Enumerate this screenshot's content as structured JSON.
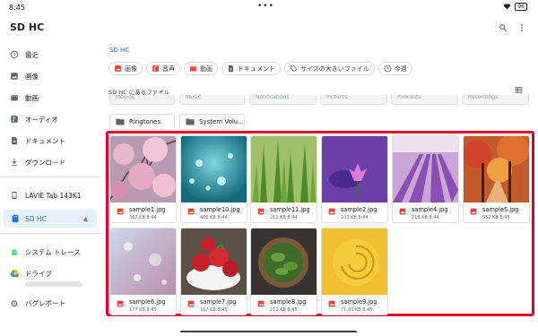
{
  "status_bar": {
    "time": "8:45",
    "dots": "•••",
    "battery": "96"
  },
  "app_bar": {
    "title": "SD HC",
    "search_icon": "search-icon",
    "more_icon": "more-vert-icon"
  },
  "sidebar": {
    "items": [
      {
        "label": "最近",
        "icon": "clock-icon"
      },
      {
        "label": "画像",
        "icon": "image-icon"
      },
      {
        "label": "動画",
        "icon": "movie-icon"
      },
      {
        "label": "オーディオ",
        "icon": "audio-icon"
      },
      {
        "label": "ドキュメント",
        "icon": "document-icon"
      },
      {
        "label": "ダウンロード",
        "icon": "download-icon"
      }
    ],
    "devices": [
      {
        "label": "LAVIE Tab 143K1",
        "icon": "tablet-icon"
      },
      {
        "label": "SD HC",
        "icon": "sd-card-icon",
        "active": true
      }
    ],
    "apps": [
      {
        "label": "システム トレース",
        "icon": "android-icon"
      },
      {
        "label": "ドライブ",
        "icon": "drive-icon"
      },
      {
        "label": "バグレポート",
        "icon": "bug-icon"
      }
    ]
  },
  "breadcrumb": "SD HC",
  "filter_chips": [
    {
      "label": "画像",
      "icon": "image-icon",
      "color": "#ea4335"
    },
    {
      "label": "音声",
      "icon": "audio-icon",
      "color": "#ea4335"
    },
    {
      "label": "動画",
      "icon": "movie-icon",
      "color": "#ea4335"
    },
    {
      "label": "ドキュメント",
      "icon": "document-icon",
      "color": "#5f6368"
    },
    {
      "label": "サイズの大きいファイル",
      "icon": "tag-icon",
      "color": "#5f6368"
    },
    {
      "label": "今週",
      "icon": "clock-icon",
      "color": "#5f6368"
    }
  ],
  "section_label": "SD HC にあるファイル",
  "cut_folders": [
    "Movies",
    "Music",
    "Notifications",
    "Pictures",
    "Podcasts",
    "Recordings"
  ],
  "folders": [
    "Ringtones",
    "System Volu..."
  ],
  "files": [
    {
      "name": "sample1.jpg",
      "info": "367 KB 8:44"
    },
    {
      "name": "sample10.jpg",
      "info": "406 KB 8:44"
    },
    {
      "name": "sample11.jpg",
      "info": "211 KB 8:44"
    },
    {
      "name": "sample2.jpg",
      "info": "103 KB 8:44"
    },
    {
      "name": "sample4.jpg",
      "info": "218 KB 8:44"
    },
    {
      "name": "sample5.jpg",
      "info": "552 KB 8:45"
    },
    {
      "name": "sample6.jpg",
      "info": "177 KB 8:45"
    },
    {
      "name": "sample7.jpg",
      "info": "167 KB 8:45"
    },
    {
      "name": "sample8.jpg",
      "info": "211 KB 8:45"
    },
    {
      "name": "sample9.jpg",
      "info": "71.83 KB 8:45"
    }
  ],
  "colors": {
    "accent": "#1a73e8",
    "selection": "#e5002b",
    "file_icon": "#ea4335"
  }
}
